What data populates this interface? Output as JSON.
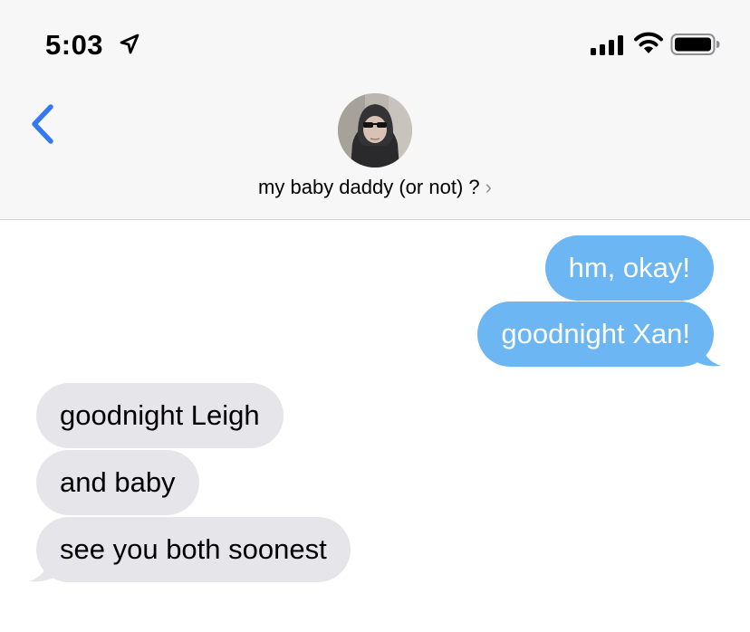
{
  "status_bar": {
    "time": "5:03"
  },
  "header": {
    "contact_name": "my baby daddy (or not) ?",
    "chevron": "›"
  },
  "icons": {
    "location": "location-arrow-icon",
    "signal": "cellular-signal-icon",
    "wifi": "wifi-icon",
    "battery": "battery-icon",
    "back": "chevron-left-icon"
  },
  "colors": {
    "accent": "#3478f6",
    "sent_bubble": "#6cb6f3",
    "received_bubble": "#e5e5ea",
    "header_bg": "#f7f7f7"
  },
  "messages": [
    {
      "direction": "sent",
      "text": "hm, okay!"
    },
    {
      "direction": "sent",
      "text": "goodnight Xan!"
    },
    {
      "direction": "received",
      "text": "goodnight Leigh"
    },
    {
      "direction": "received",
      "text": "and baby"
    },
    {
      "direction": "received",
      "text": "see you both soonest"
    }
  ]
}
